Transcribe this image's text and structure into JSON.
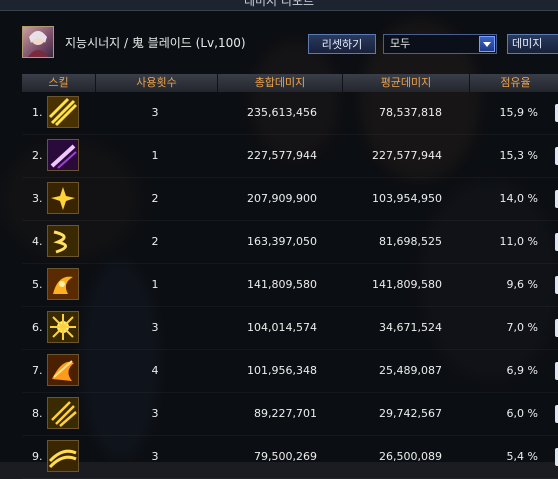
{
  "window": {
    "title": "데미지 리포트"
  },
  "player": {
    "name": "지능시너지 / 鬼 블레이드 (Lv,100)"
  },
  "controls": {
    "reset_label": "리셋하기",
    "filter_value": "모두",
    "damage_label": "데미지"
  },
  "table": {
    "headers": {
      "skill": "스킬",
      "uses": "사용횟수",
      "total": "총합데미지",
      "avg": "평균데미지",
      "share": "점유율"
    },
    "rows": [
      {
        "index": "1.",
        "icon": "slash-icon-yellow",
        "uses": "3",
        "total": "235,613,456",
        "avg": "78,537,818",
        "share": "15,9 %"
      },
      {
        "index": "2.",
        "icon": "slash-icon-purple",
        "uses": "1",
        "total": "227,577,944",
        "avg": "227,577,944",
        "share": "15,3 %"
      },
      {
        "index": "3.",
        "icon": "spark-burst-icon",
        "uses": "2",
        "total": "207,909,900",
        "avg": "103,954,950",
        "share": "14,0 %"
      },
      {
        "index": "4.",
        "icon": "lightning-swirl-icon",
        "uses": "2",
        "total": "163,397,050",
        "avg": "81,698,525",
        "share": "11,0 %"
      },
      {
        "index": "5.",
        "icon": "flame-dragon-icon",
        "uses": "1",
        "total": "141,809,580",
        "avg": "141,809,580",
        "share": "9,6 %"
      },
      {
        "index": "6.",
        "icon": "starburst-icon",
        "uses": "3",
        "total": "104,014,574",
        "avg": "34,671,524",
        "share": "7,0 %"
      },
      {
        "index": "7.",
        "icon": "flame-slash-icon",
        "uses": "4",
        "total": "101,956,348",
        "avg": "25,489,087",
        "share": "6,9 %"
      },
      {
        "index": "8.",
        "icon": "triple-slash-icon",
        "uses": "3",
        "total": "89,227,701",
        "avg": "29,742,567",
        "share": "6,0 %"
      },
      {
        "index": "9.",
        "icon": "wave-slash-icon",
        "uses": "3",
        "total": "79,500,269",
        "avg": "26,500,089",
        "share": "5,4 %"
      }
    ]
  },
  "colors": {
    "header_text": "#f0a34a",
    "accent_blue": "#3b64c4"
  }
}
